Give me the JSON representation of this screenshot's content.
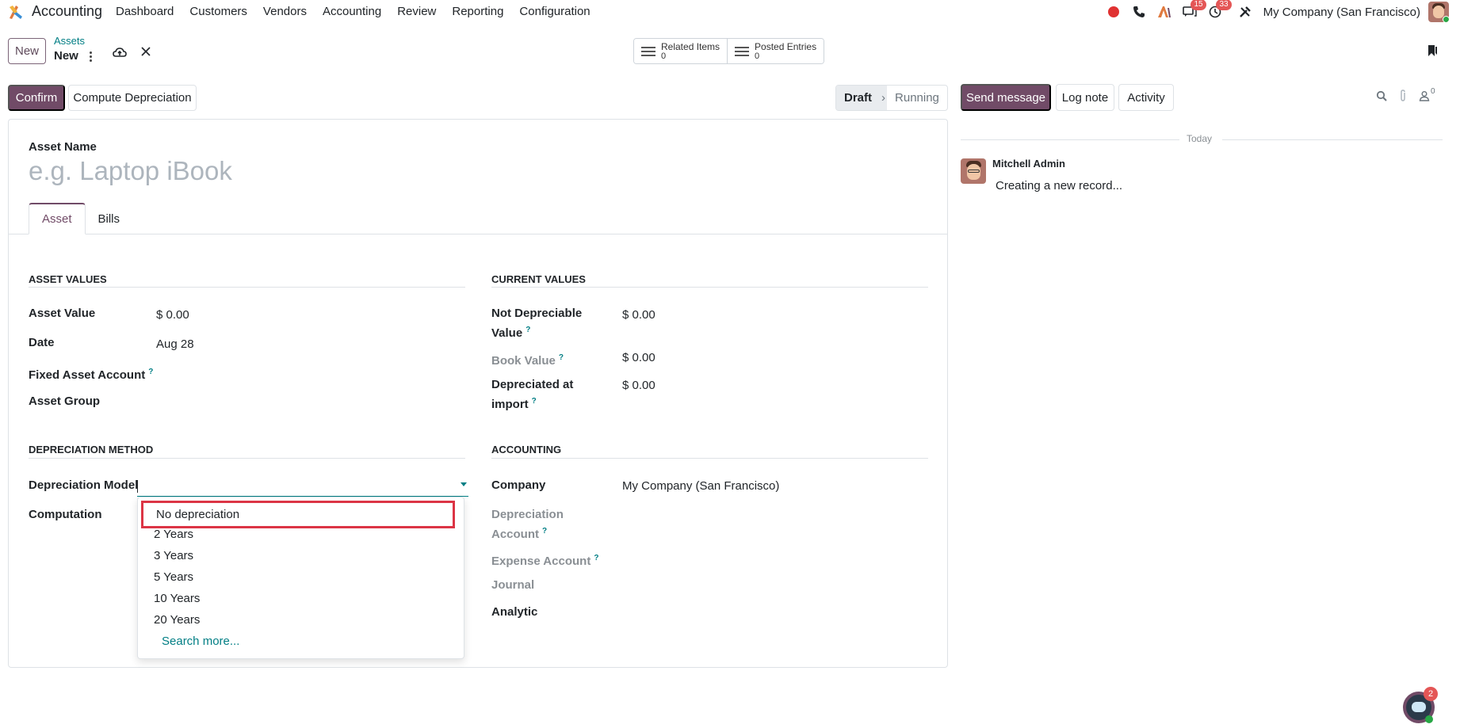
{
  "navbar": {
    "app_name": "Accounting",
    "menu": [
      "Dashboard",
      "Customers",
      "Vendors",
      "Accounting",
      "Review",
      "Reporting",
      "Configuration"
    ],
    "messages_badge": "15",
    "activities_badge": "33",
    "company": "My Company (San Francisco)"
  },
  "control_panel": {
    "new_label": "New",
    "breadcrumb_parent": "Assets",
    "breadcrumb_current": "New",
    "smart_buttons": [
      {
        "label": "Related Items",
        "value": "0"
      },
      {
        "label": "Posted Entries",
        "value": "0"
      }
    ]
  },
  "statusbar": {
    "confirm_label": "Confirm",
    "compute_label": "Compute Depreciation",
    "steps": [
      "Draft",
      "Running"
    ]
  },
  "form": {
    "asset_name_label": "Asset Name",
    "asset_name_placeholder": "e.g. Laptop iBook",
    "tabs": [
      "Asset",
      "Bills"
    ],
    "asset_values": {
      "title": "ASSET VALUES",
      "asset_value_label": "Asset Value",
      "asset_value": "$ 0.00",
      "date_label": "Date",
      "date_value": "Aug 28",
      "fixed_asset_account_label": "Fixed Asset Account",
      "asset_group_label": "Asset Group"
    },
    "current_values": {
      "title": "CURRENT VALUES",
      "not_depreciable_label_1": "Not Depreciable",
      "not_depreciable_label_2": "Value",
      "not_depreciable_value": "$ 0.00",
      "book_value_label": "Book Value",
      "book_value": "$ 0.00",
      "depreciated_label_1": "Depreciated at",
      "depreciated_label_2": "import",
      "depreciated_value": "$ 0.00"
    },
    "depreciation_method": {
      "title": "DEPRECIATION METHOD",
      "model_label": "Depreciation Model",
      "computation_label": "Computation"
    },
    "accounting": {
      "title": "ACCOUNTING",
      "company_label": "Company",
      "company_value": "My Company (San Francisco)",
      "depreciation_account_label_1": "Depreciation",
      "depreciation_account_label_2": "Account",
      "expense_account_label": "Expense Account",
      "journal_label": "Journal",
      "analytic_label": "Analytic"
    },
    "help_mark": "?"
  },
  "dropdown": {
    "options": [
      "No depreciation",
      "2 Years",
      "3 Years",
      "5 Years",
      "10 Years",
      "20 Years"
    ],
    "search_more": "Search more..."
  },
  "chatter": {
    "send_message": "Send message",
    "log_note": "Log note",
    "activity": "Activity",
    "followers_count": "0",
    "separator": "Today",
    "author": "Mitchell Admin",
    "message": "Creating a new record..."
  },
  "livechat": {
    "badge": "2"
  },
  "colors": {
    "brand": "#714b67",
    "link": "#017e84",
    "highlight": "#dc3545"
  },
  "icons": [
    "app-logo-icon",
    "recording-icon",
    "phone-icon",
    "ai-icon",
    "messages-icon",
    "clock-icon",
    "tools-icon",
    "cloud-upload-icon",
    "close-icon",
    "bookmark-icon",
    "search-icon",
    "paperclip-icon",
    "followers-icon"
  ]
}
